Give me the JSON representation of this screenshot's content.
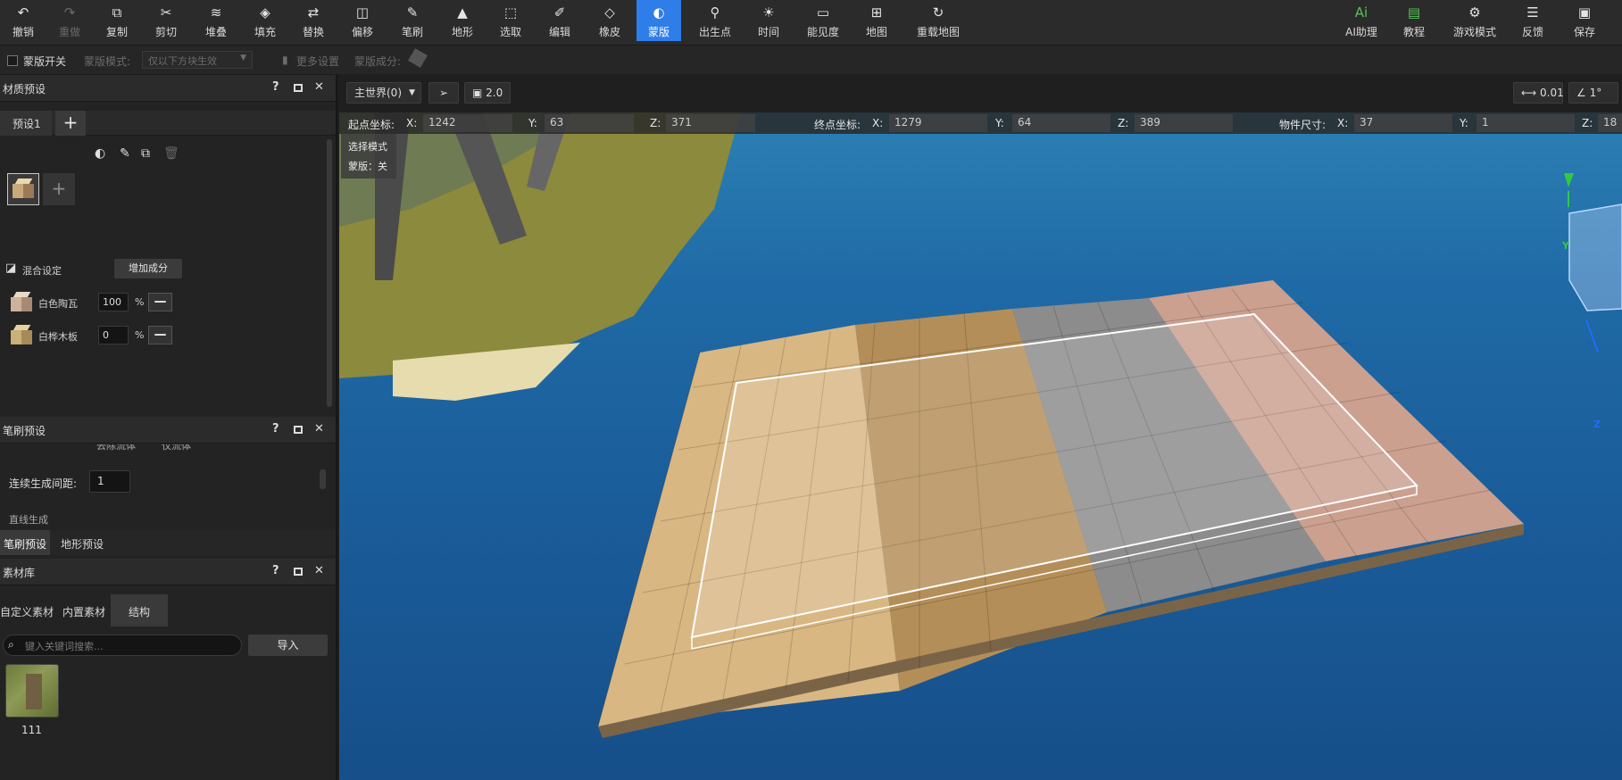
{
  "toolbar": {
    "items": [
      {
        "label": "撤销",
        "icon": "undo-icon"
      },
      {
        "label": "重做",
        "icon": "redo-icon"
      },
      {
        "label": "复制",
        "icon": "copy-icon"
      },
      {
        "label": "剪切",
        "icon": "cut-icon"
      },
      {
        "label": "堆叠",
        "icon": "stack-icon"
      },
      {
        "label": "填充",
        "icon": "fill-icon"
      },
      {
        "label": "替换",
        "icon": "replace-icon"
      },
      {
        "label": "偏移",
        "icon": "offset-icon"
      },
      {
        "label": "笔刷",
        "icon": "brush-icon"
      },
      {
        "label": "地形",
        "icon": "terrain-icon"
      },
      {
        "label": "选取",
        "icon": "select-icon"
      },
      {
        "label": "编辑",
        "icon": "edit-icon"
      },
      {
        "label": "橡皮",
        "icon": "eraser-icon"
      },
      {
        "label": "蒙版",
        "icon": "mask-icon"
      },
      {
        "label": "出生点",
        "icon": "spawn-point-icon"
      },
      {
        "label": "时间",
        "icon": "time-icon"
      },
      {
        "label": "能见度",
        "icon": "visibility-icon"
      },
      {
        "label": "地图",
        "icon": "map-icon"
      },
      {
        "label": "重载地图",
        "icon": "reload-icon"
      }
    ],
    "right_items": [
      {
        "label": "AI助理",
        "icon": "ai-assistant-icon"
      },
      {
        "label": "教程",
        "icon": "tutorial-icon"
      },
      {
        "label": "游戏模式",
        "icon": "game-mode-icon"
      },
      {
        "label": "反馈",
        "icon": "feedback-icon"
      },
      {
        "label": "保存",
        "icon": "save-icon"
      }
    ]
  },
  "maskbar": {
    "toggle_label": "蒙版开关",
    "mode_label": "蒙版模式:",
    "mode_value": "仅以下方块生效",
    "more_settings": "更多设置",
    "component_label": "蒙版成分:"
  },
  "material_panel": {
    "title": "材质预设",
    "help": "?",
    "close": "✕",
    "preset_tab": "预设1",
    "add_tab": "+",
    "mix_label": "混合设定",
    "add_component": "增加成分",
    "materials": [
      {
        "name": "白色陶瓦",
        "value": "100",
        "unit": "%"
      },
      {
        "name": "白桦木板",
        "value": "0",
        "unit": "%"
      }
    ]
  },
  "brush_panel": {
    "title": "笔刷预设",
    "help": "?",
    "close": "✕",
    "cut_text_1": "去除流体",
    "cut_text_2": "仅流体",
    "interval_label": "连续生成间距:",
    "interval_value": "1",
    "cut_text_3": "直线生成",
    "tab_brush": "笔刷预设",
    "tab_terrain": "地形预设"
  },
  "library_panel": {
    "title": "素材库",
    "help": "?",
    "close": "✕",
    "tab_custom": "自定义素材",
    "tab_builtin": "内置素材",
    "tab_structure": "结构",
    "search_placeholder": "键入关键词搜索...",
    "import": "导入",
    "item_name": "111"
  },
  "viewport": {
    "world": "主世界(0)",
    "speed": "2.0",
    "step": "0.01",
    "angle": "1°",
    "start_label": "起点坐标:",
    "start": {
      "x": "1242",
      "y": "63",
      "z": "371"
    },
    "end_label": "终点坐标:",
    "end": {
      "x": "1279",
      "y": "64",
      "z": "389"
    },
    "size_label": "物件尺寸:",
    "size": {
      "x": "37",
      "y": "1",
      "z": "18"
    },
    "mode_line1": "选择模式",
    "mode_line2": "蒙版：关",
    "lbl_x": "X:",
    "lbl_y": "Y:",
    "lbl_z": "Z:",
    "axis_y": "Y",
    "axis_z": "Z"
  },
  "colors": {
    "accent": "#2e7de9",
    "water": "#1a5d9a",
    "birch": "#d6b581",
    "oak": "#b8925a",
    "stone": "#8a8a8a",
    "terracotta": "#c8a090"
  }
}
